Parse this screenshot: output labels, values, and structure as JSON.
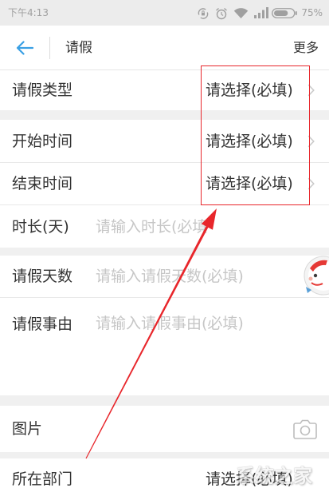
{
  "status_bar": {
    "time": "下午4:13",
    "battery_text": "75%",
    "battery_level": 0.75,
    "icons": [
      "rotation-lock-icon",
      "alarm-icon",
      "wifi-icon",
      "signal-icon",
      "battery-icon"
    ]
  },
  "nav": {
    "back_icon": "arrow-left-icon",
    "title": "请假",
    "more_label": "更多"
  },
  "form": {
    "leave_type": {
      "label": "请假类型",
      "value": "请选择(必填)",
      "icon": "chevron-right-icon"
    },
    "start_time": {
      "label": "开始时间",
      "value": "请选择(必填)",
      "icon": "chevron-right-icon"
    },
    "end_time": {
      "label": "结束时间",
      "value": "请选择(必填)",
      "icon": "chevron-right-icon"
    },
    "duration_days": {
      "label": "时长(天)",
      "placeholder": "请输入时长(必填"
    },
    "leave_days": {
      "label": "请假天数",
      "placeholder": "请输入请假天数(必填)"
    },
    "reason": {
      "label": "请假事由",
      "placeholder": "请输入请假事由(必填)"
    },
    "picture": {
      "label": "图片",
      "icon": "camera-icon"
    },
    "department": {
      "label": "所在部门",
      "value": "请选择(必填)"
    }
  },
  "overlays": {
    "floating_widget_icon": "floating-assistant-icon",
    "watermark": "系统之家"
  },
  "colors": {
    "accent": "#3aa0e4",
    "annotation": "#e8262b",
    "text": "#333333",
    "placeholder": "#c6c6c6",
    "muted": "#a0a0a0",
    "background": "#f0f0f0"
  }
}
